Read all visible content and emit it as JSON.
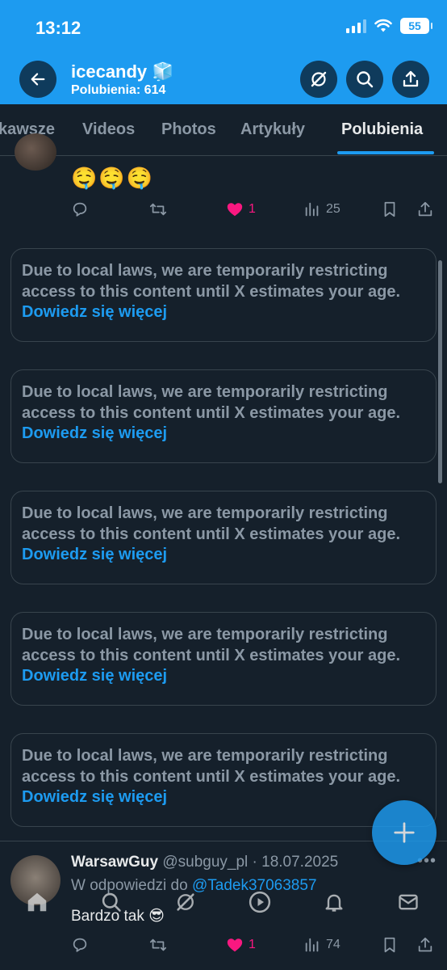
{
  "status_bar": {
    "time": "13:12",
    "battery": "55"
  },
  "profile": {
    "name": "icecandy",
    "name_emoji": "🧊",
    "likes_count": "Polubienia: 614"
  },
  "tabs": [
    {
      "label": "kawsze"
    },
    {
      "label": "Videos"
    },
    {
      "label": "Photos"
    },
    {
      "label": "Artykuły"
    },
    {
      "label": "Polubienia",
      "active": true
    }
  ],
  "tweet1": {
    "emojis": "🤤🤤🤤",
    "likes": "1",
    "views": "25"
  },
  "restricted_notice": {
    "text": "Due to local laws, we are temporarily restricting access to this content until X estimates your age.",
    "link": "Dowiedz się więcej"
  },
  "tweet2": {
    "name": "WarsawGuy",
    "handle_date": "@subguy_pl · 18.07.2025",
    "reply_prefix": "W odpowiedzi do",
    "reply_to": "@Tadek37063857",
    "text": "Bardzo tak 😎",
    "likes": "1",
    "views": "74"
  },
  "colors": {
    "accent": "#1d9bf0",
    "background": "#15202b",
    "like": "#f91880",
    "muted": "#8b98a5"
  },
  "icons": [
    "back-arrow-icon",
    "grok-icon",
    "search-icon",
    "share-icon",
    "reply-icon",
    "retweet-icon",
    "heart-icon",
    "views-icon",
    "bookmark-icon",
    "plus-icon",
    "home-icon",
    "mail-icon",
    "bell-icon",
    "play-icon"
  ]
}
